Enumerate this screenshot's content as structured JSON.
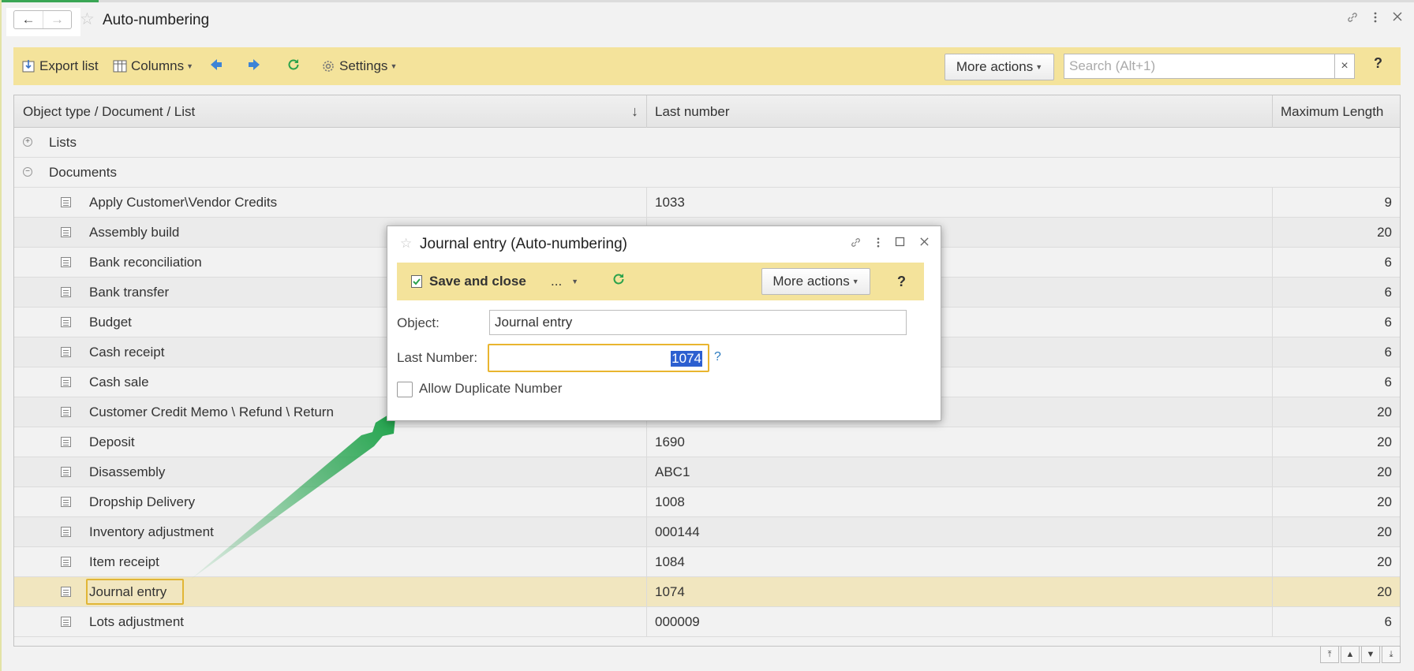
{
  "window": {
    "title": "Auto-numbering",
    "back_icon": "←",
    "forward_icon": "→",
    "star_icon": "☆"
  },
  "toolbar": {
    "export_label": "Export list",
    "columns_label": "Columns",
    "settings_label": "Settings",
    "more_actions_label": "More actions",
    "search_placeholder": "Search (Alt+1)",
    "clear_label": "×",
    "help_label": "?"
  },
  "table": {
    "headers": {
      "object": "Object type / Document / List",
      "sort_indicator": "↓",
      "last_number": "Last number",
      "max_length": "Maximum Length"
    },
    "groups": {
      "lists": {
        "label": "Lists",
        "toggle": "+"
      },
      "documents": {
        "label": "Documents",
        "toggle": "−"
      }
    },
    "rows": [
      {
        "name": "Apply Customer\\Vendor Credits",
        "last": "1033",
        "max": "9"
      },
      {
        "name": "Assembly build",
        "last": "",
        "max": "20"
      },
      {
        "name": "Bank reconciliation",
        "last": "",
        "max": "6"
      },
      {
        "name": "Bank transfer",
        "last": "",
        "max": "6"
      },
      {
        "name": "Budget",
        "last": "",
        "max": "6"
      },
      {
        "name": "Cash receipt",
        "last": "",
        "max": "6"
      },
      {
        "name": "Cash sale",
        "last": "",
        "max": "6"
      },
      {
        "name": "Customer Credit Memo \\ Refund \\ Return",
        "last": "",
        "max": "20"
      },
      {
        "name": "Deposit",
        "last": "1690",
        "max": "20"
      },
      {
        "name": "Disassembly",
        "last": "ABC1",
        "max": "20"
      },
      {
        "name": "Dropship Delivery",
        "last": "1008",
        "max": "20"
      },
      {
        "name": "Inventory adjustment",
        "last": "000144",
        "max": "20"
      },
      {
        "name": "Item receipt",
        "last": "1084",
        "max": "20"
      },
      {
        "name": "Journal entry",
        "last": "1074",
        "max": "20"
      },
      {
        "name": "Lots adjustment",
        "last": "000009",
        "max": "6"
      }
    ]
  },
  "dialog": {
    "title": "Journal entry (Auto-numbering)",
    "save_close_label": "Save and close",
    "more_label": "...",
    "more_actions_label": "More actions",
    "help_label": "?",
    "object_label": "Object:",
    "object_value": "Journal entry",
    "last_number_label": "Last Number:",
    "last_number_value": "1074",
    "hint": "?",
    "allow_duplicate_label": "Allow Duplicate Number"
  },
  "colors": {
    "toolbar_bg": "#f4e39b",
    "selected_row": "#f1e6bf",
    "focus_border": "#e9b52f",
    "arrow_green": "#1fa24a"
  }
}
